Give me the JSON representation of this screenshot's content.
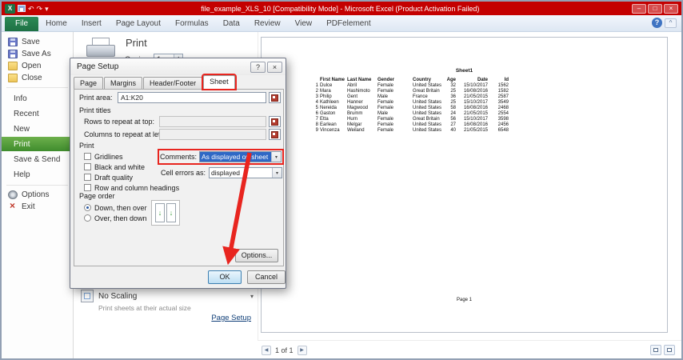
{
  "window": {
    "title": "file_example_XLS_10 [Compatibility Mode] - Microsoft Excel (Product Activation Failed)"
  },
  "icons": {
    "minimize": "–",
    "maximize": "□",
    "close": "×",
    "help": "?",
    "caret_up": "^",
    "caret_down": "▾",
    "undo": "↶",
    "redo": "↷",
    "prev": "◀",
    "next": "▶",
    "spin_up": "▴",
    "spin_down": "▾",
    "dropdown": "▾"
  },
  "ribbon": {
    "file_tab": "File",
    "tabs": [
      "Home",
      "Insert",
      "Page Layout",
      "Formulas",
      "Data",
      "Review",
      "View",
      "PDFelement"
    ]
  },
  "backstage": {
    "items": [
      {
        "label": "Save",
        "icon": "save-icon"
      },
      {
        "label": "Save As",
        "icon": "save-as-icon"
      },
      {
        "label": "Open",
        "icon": "open-icon"
      },
      {
        "label": "Close",
        "icon": "close-icon"
      },
      {
        "sep": true
      },
      {
        "label": "Info",
        "tab": true
      },
      {
        "label": "Recent",
        "tab": true
      },
      {
        "label": "New",
        "tab": true
      },
      {
        "label": "Print",
        "tab": true,
        "active": true
      },
      {
        "label": "Save & Send",
        "tab": true
      },
      {
        "label": "Help",
        "tab": true
      },
      {
        "sep": true
      },
      {
        "label": "Options",
        "icon": "options-icon"
      },
      {
        "label": "Exit",
        "icon": "exit-icon"
      }
    ],
    "print_heading": "Print",
    "copies_label": "Copies:",
    "copies_value": "1",
    "scaling_label": "No Scaling",
    "scaling_sub": "Print sheets at their actual size",
    "page_setup_link": "Page Setup"
  },
  "dialog": {
    "title": "Page Setup",
    "tabs": [
      "Page",
      "Margins",
      "Header/Footer",
      "Sheet"
    ],
    "active_tab": "Sheet",
    "print_area_label": "Print area:",
    "print_area_value": "A1:K20",
    "print_titles_label": "Print titles",
    "rows_repeat_label": "Rows to repeat at top:",
    "cols_repeat_label": "Columns to repeat at left:",
    "print_group_label": "Print",
    "checkboxes": [
      "Gridlines",
      "Black and white",
      "Draft quality",
      "Row and column headings"
    ],
    "comments_label": "Comments:",
    "comments_value": "As displayed on sheet",
    "cell_errors_label": "Cell errors as:",
    "cell_errors_value": "displayed",
    "page_order_label": "Page order",
    "page_order_options": [
      "Down, then over",
      "Over, then down"
    ],
    "selected_page_order": "Down, then over",
    "options_button": "Options...",
    "ok_button": "OK",
    "cancel_button": "Cancel"
  },
  "preview": {
    "sheet_title": "Sheet1",
    "columns": [
      "",
      "First Name",
      "Last Name",
      "Gender",
      "Country",
      "Age",
      "Date",
      "Id"
    ],
    "rows": [
      [
        "1",
        "Dulce",
        "Abril",
        "Female",
        "United States",
        "32",
        "15/10/2017",
        "1562"
      ],
      [
        "2",
        "Mara",
        "Hashimoto",
        "Female",
        "Great Britain",
        "25",
        "16/08/2016",
        "1582"
      ],
      [
        "3",
        "Philip",
        "Gent",
        "Male",
        "France",
        "36",
        "21/05/2015",
        "2587"
      ],
      [
        "4",
        "Kathleen",
        "Hanner",
        "Female",
        "United States",
        "25",
        "15/10/2017",
        "3549"
      ],
      [
        "5",
        "Nereida",
        "Magwood",
        "Female",
        "United States",
        "58",
        "16/08/2016",
        "2468"
      ],
      [
        "6",
        "Gaston",
        "Brumm",
        "Male",
        "United States",
        "24",
        "21/05/2015",
        "2554"
      ],
      [
        "7",
        "Etta",
        "Hurn",
        "Female",
        "Great Britain",
        "56",
        "15/10/2017",
        "3598"
      ],
      [
        "8",
        "Earlean",
        "Melgar",
        "Female",
        "United States",
        "27",
        "16/08/2016",
        "2456"
      ],
      [
        "9",
        "Vincenza",
        "Weiland",
        "Female",
        "United States",
        "40",
        "21/05/2015",
        "6548"
      ]
    ],
    "page_footer": "Page 1",
    "nav": "1 of 1"
  }
}
